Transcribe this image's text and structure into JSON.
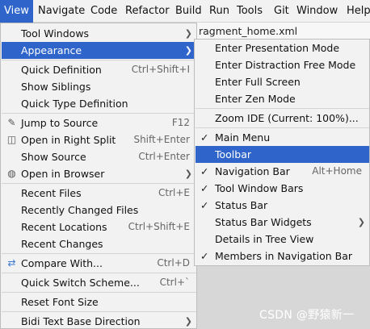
{
  "menubar": [
    {
      "label": "View",
      "active": true
    },
    {
      "label": "Navigate"
    },
    {
      "label": "Code"
    },
    {
      "label": "Refactor"
    },
    {
      "label": "Build"
    },
    {
      "label": "Run"
    },
    {
      "label": "Tools"
    },
    {
      "label": "Git"
    },
    {
      "label": "Window"
    },
    {
      "label": "Help"
    }
  ],
  "editor_tab_text": "ragment_home.xml",
  "view_menu": {
    "tool_windows": "Tool Windows",
    "appearance": "Appearance",
    "quick_definition": "Quick Definition",
    "quick_definition_sc": "Ctrl+Shift+I",
    "show_siblings": "Show Siblings",
    "quick_type_definition": "Quick Type Definition",
    "jump_to_source": "Jump to Source",
    "jump_to_source_sc": "F12",
    "open_in_right_split": "Open in Right Split",
    "open_in_right_split_sc": "Shift+Enter",
    "show_source": "Show Source",
    "show_source_sc": "Ctrl+Enter",
    "open_in_browser": "Open in Browser",
    "recent_files": "Recent Files",
    "recent_files_sc": "Ctrl+E",
    "recently_changed_files": "Recently Changed Files",
    "recent_locations": "Recent Locations",
    "recent_locations_sc": "Ctrl+Shift+E",
    "recent_changes": "Recent Changes",
    "compare_with": "Compare With...",
    "compare_with_sc": "Ctrl+D",
    "quick_switch_scheme": "Quick Switch Scheme...",
    "quick_switch_scheme_sc": "Ctrl+`",
    "reset_font_size": "Reset Font Size",
    "bidi_text_base_direction": "Bidi Text Base Direction"
  },
  "appearance_menu": {
    "enter_presentation_mode": "Enter Presentation Mode",
    "enter_distraction_free_mode": "Enter Distraction Free Mode",
    "enter_full_screen": "Enter Full Screen",
    "enter_zen_mode": "Enter Zen Mode",
    "zoom_ide": "Zoom IDE (Current: 100%)...",
    "main_menu": "Main Menu",
    "toolbar": "Toolbar",
    "navigation_bar": "Navigation Bar",
    "navigation_bar_sc": "Alt+Home",
    "tool_window_bars": "Tool Window Bars",
    "status_bar": "Status Bar",
    "status_bar_widgets": "Status Bar Widgets",
    "details_in_tree_view": "Details in Tree View",
    "members_in_navigation_bar": "Members in Navigation Bar",
    "check_glyph": "✓"
  },
  "watermark": "CSDN @野猿新一",
  "colors": {
    "selection": "#2f65ca",
    "menu_bg": "#f2f2f2",
    "separator": "#d4d4d4"
  }
}
